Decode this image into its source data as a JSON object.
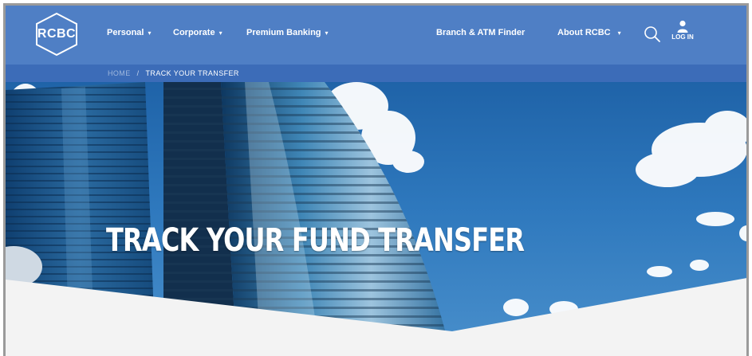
{
  "brand": {
    "logo_text": "RCBC"
  },
  "nav": {
    "left_items": [
      {
        "label": "Personal"
      },
      {
        "label": "Corporate"
      },
      {
        "label": "Premium Banking"
      }
    ],
    "right_items": [
      {
        "label": "Branch & ATM Finder"
      },
      {
        "label": "About RCBC"
      }
    ],
    "login_label": "LOG IN"
  },
  "breadcrumb": {
    "home": "HOME",
    "separator": "/",
    "current": "TRACK YOUR TRANSFER"
  },
  "hero": {
    "title": "TRACK YOUR FUND TRANSFER"
  },
  "colors": {
    "nav_bg": "#4f7fc5",
    "breadcrumb_bg": "#3c6cb8",
    "sky": "#2e78bd",
    "content_bg": "#f3f3f3"
  },
  "icons": [
    "hexagon-logo",
    "chevron-down-icon",
    "search-icon",
    "user-icon"
  ]
}
